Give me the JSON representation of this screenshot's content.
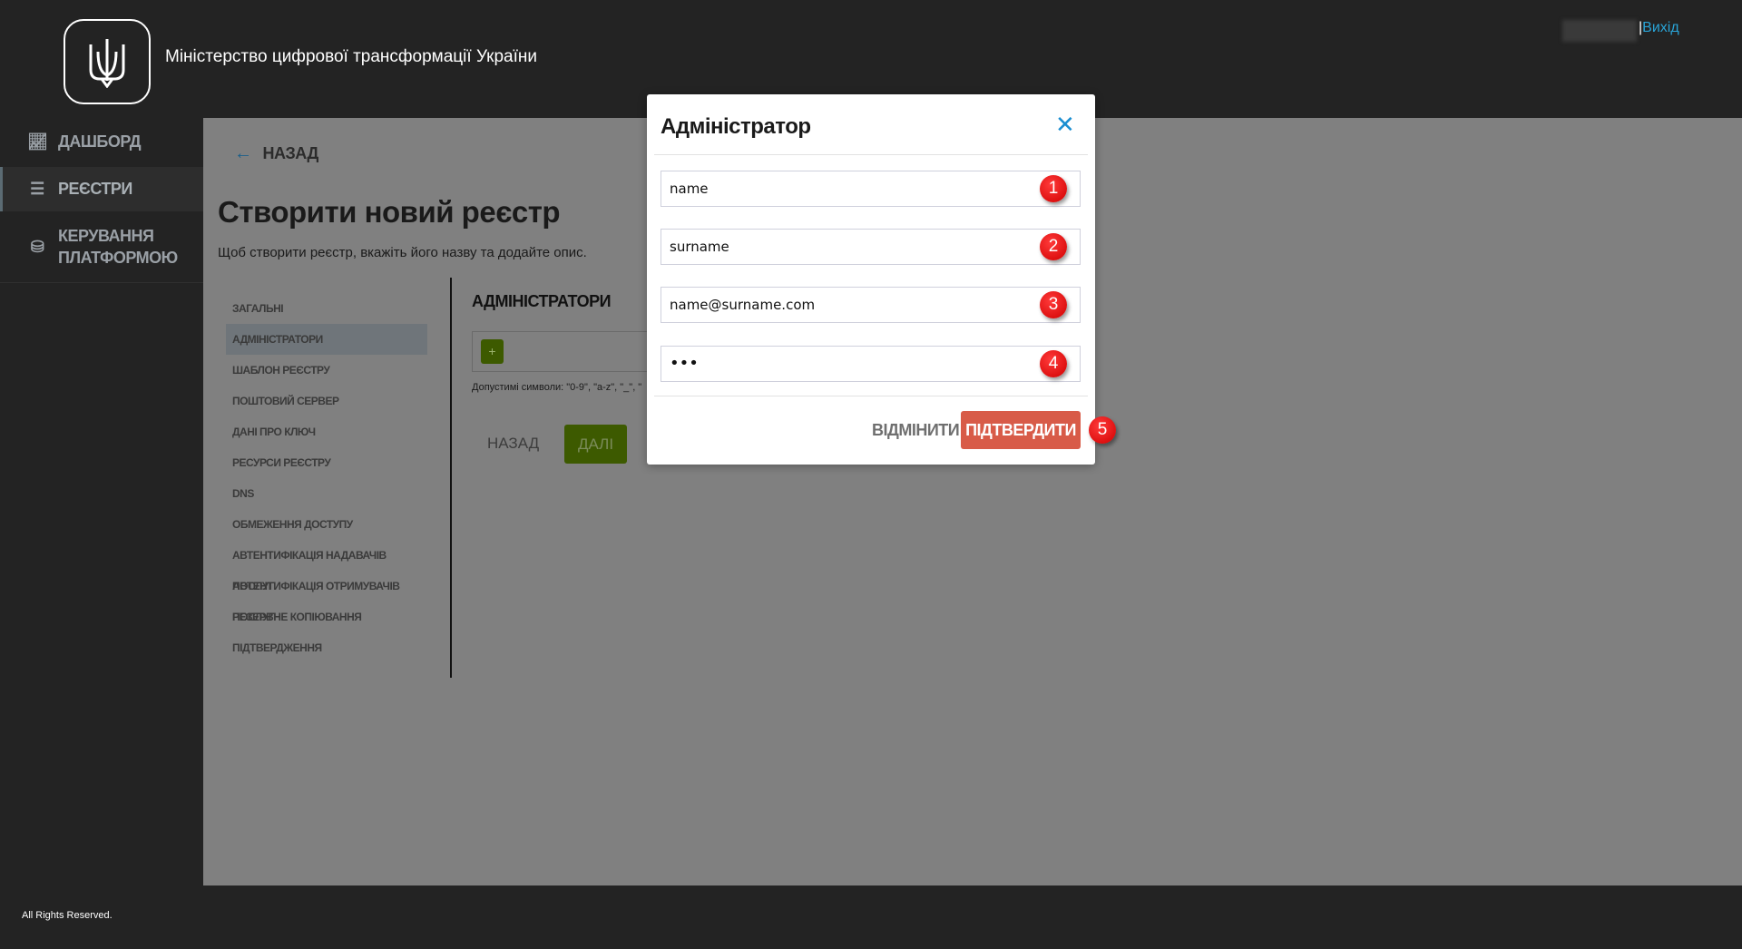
{
  "header": {
    "org_name": "Міністерство цифрової трансформації України",
    "logout": "Вихід",
    "separator": "|"
  },
  "sidebar": {
    "items": [
      {
        "label": "Дашборд",
        "icon": "chart-icon"
      },
      {
        "label": "Реєстри",
        "icon": "list-icon",
        "active": true
      },
      {
        "label": "Керування платформою",
        "icon": "database-gear-icon"
      }
    ]
  },
  "page": {
    "back": "НАЗАД",
    "title": "Створити новий реєстр",
    "subtitle": "Щоб створити реєстр, вкажіть його назву та додайте опис.",
    "steps": [
      "Загальні",
      "Адміністратори",
      "Шаблон реєстру",
      "Поштовий сервер",
      "Дані про ключ",
      "Ресурси реєстру",
      "DNS",
      "Обмеження доступу",
      "Автентифікація надавачів послуг",
      "Автентифікація отримувачів послуг",
      "Резервне копіювання",
      "Підтвердження"
    ],
    "active_step": 1,
    "section_title": "АДМІНІСТРАТОРИ",
    "add_button": "+",
    "hint": "Допустимі символи: \"0-9\", \"a-z\", \"_\", \"",
    "back_button": "НАЗАД",
    "next_button": "ДАЛІ"
  },
  "modal": {
    "title": "Адміністратор",
    "fields": [
      {
        "value": "name",
        "badge": "1"
      },
      {
        "value": "surname",
        "badge": "2"
      },
      {
        "value": "name@surname.com",
        "badge": "3"
      },
      {
        "value": "•••",
        "badge": "4"
      }
    ],
    "cancel": "ВІДМІНИТИ",
    "confirm": "ПІДТВЕРДИТИ",
    "confirm_badge": "5"
  },
  "footer": {
    "text": "All Rights Reserved."
  },
  "colors": {
    "accent_green": "#3d5a00",
    "confirm_red": "#d85b48",
    "link_blue": "#29a3d6",
    "badge_red": "#e00000"
  }
}
